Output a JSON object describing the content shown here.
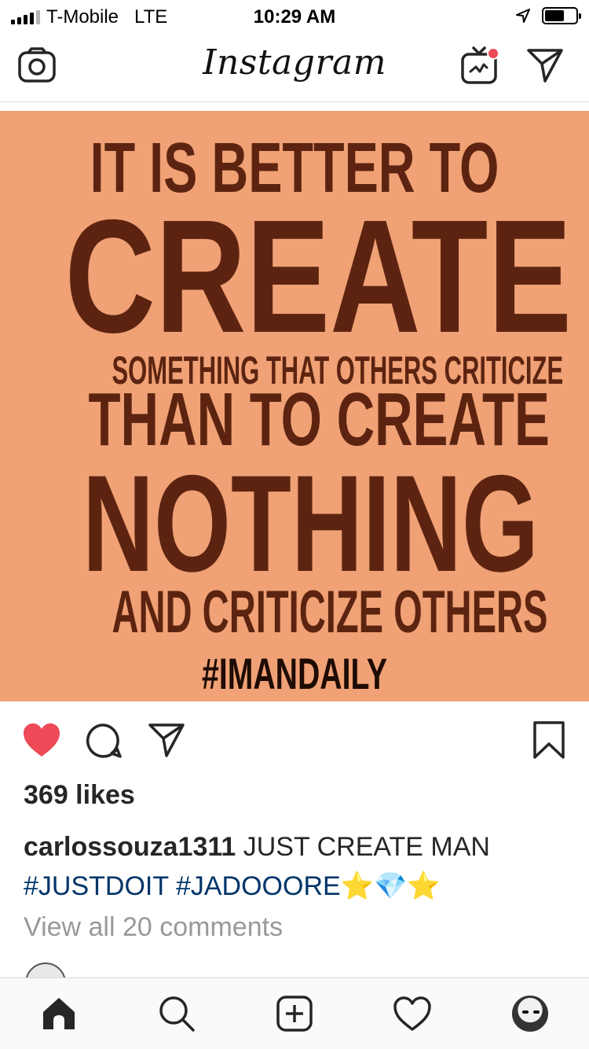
{
  "status_bar": {
    "carrier": "T-Mobile",
    "network": "LTE",
    "time": "10:29 AM"
  },
  "header": {
    "app_name": "Instagram",
    "icons": [
      "camera-icon",
      "igtv-icon",
      "direct-message-icon"
    ],
    "notification_dot_color": "#ed4956"
  },
  "post": {
    "image": {
      "background_color": "#f0a175",
      "text_color": "#5c2410",
      "lines": [
        "IT IS BETTER TO",
        "CREATE",
        "SOMETHING THAT OTHERS CRITICIZE",
        "THAN TO CREATE",
        "NOTHING",
        "AND CRITICIZE OTHERS",
        "#IMANDAILY"
      ]
    },
    "actions": {
      "liked": true,
      "like_color": "#ed4956",
      "icons": [
        "heart-icon",
        "comment-icon",
        "share-icon",
        "bookmark-icon"
      ]
    },
    "likes": "369 likes",
    "caption": {
      "username": "carlossouza1311",
      "text": "JUST CREATE MAN",
      "hashtag_1": "#JUSTDOIT",
      "hashtag_2": "#JADOOORE",
      "emoji_star": "⭐",
      "emoji_gem": "💎"
    },
    "view_comments": "View all 20 comments"
  },
  "tab_bar": {
    "icons": [
      "home-icon",
      "search-icon",
      "new-post-icon",
      "activity-heart-icon",
      "profile-avatar"
    ]
  }
}
